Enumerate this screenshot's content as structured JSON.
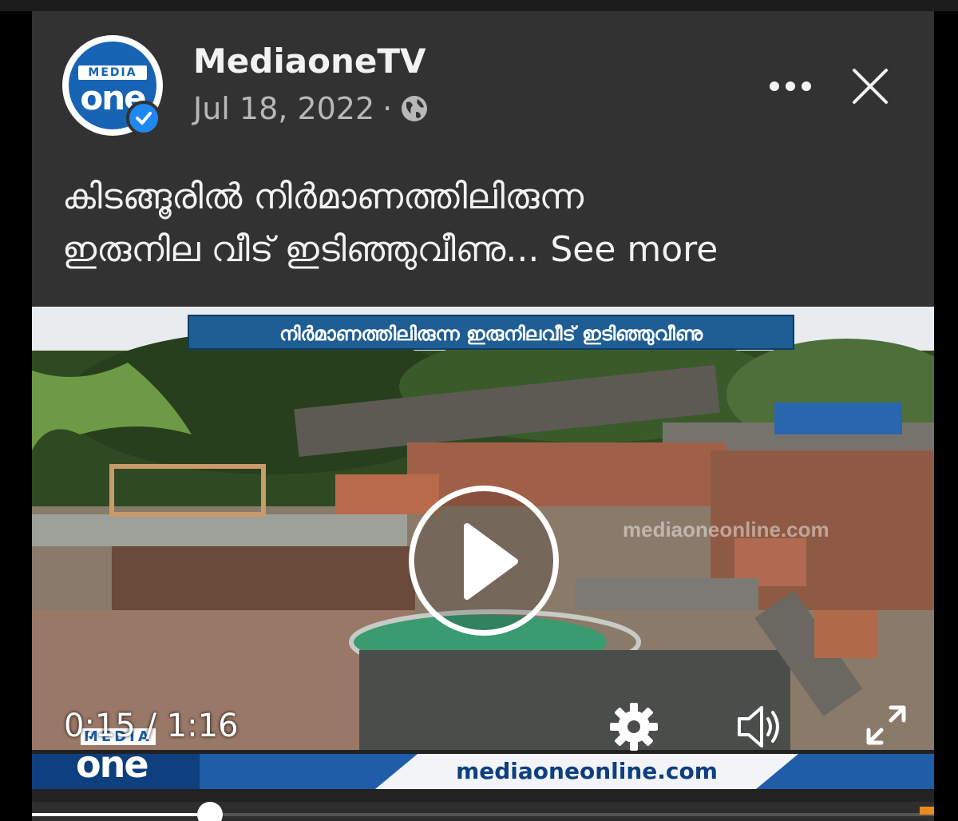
{
  "post": {
    "page_name": "MediaoneTV",
    "date": "Jul 18, 2022",
    "separator": "·",
    "privacy_icon": "globe-icon",
    "verified_icon": "verified-badge-icon",
    "avatar": {
      "top_text": "MEDIA",
      "bottom_text": "one"
    },
    "caption_line1": "കിടങ്ങൂരിൽ നിർമാണത്തിലിരുന്ന",
    "caption_line2": "ഇരുനില വീട് ഇടിഞ്ഞുവീണു...",
    "see_more": "See more"
  },
  "header_actions": {
    "more_icon": "more-dots-icon",
    "close_icon": "close-icon"
  },
  "video": {
    "headline_banner": "നിർമാണത്തിലിരുന്ന ഇരുനിലവീട് ഇടിഞ്ഞുവീണു",
    "current_time": "0:15",
    "time_separator": " / ",
    "duration": "1:16",
    "progress_fraction": 0.1974,
    "watermark_url": "mediaoneonline.com",
    "lower_third_url": "mediaoneonline.com",
    "logo_top": "MEDIA",
    "logo_bottom": "one",
    "controls": [
      "play-icon",
      "settings-gear-icon",
      "volume-icon",
      "fullscreen-icon"
    ]
  },
  "colors": {
    "card_bg": "#323232",
    "verified_blue": "#1e88f0",
    "brand_blue": "#1f5da8"
  }
}
